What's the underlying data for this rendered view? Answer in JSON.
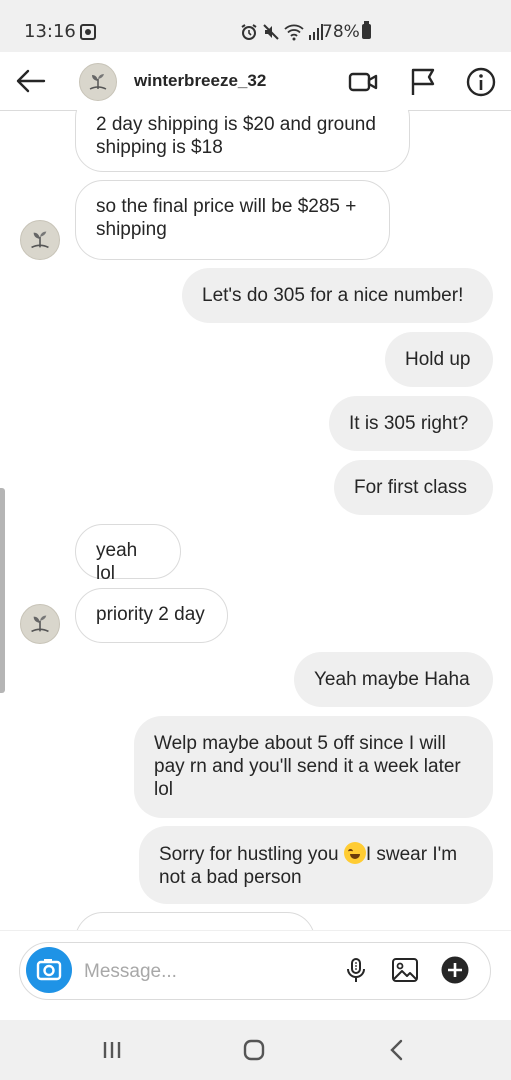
{
  "status_bar": {
    "time": "13:16",
    "battery": "78%",
    "icons": [
      "photo-notification-icon",
      "alarm-icon",
      "mute-icon",
      "wifi-icon",
      "signal-icon",
      "battery-icon"
    ]
  },
  "header": {
    "username": "winterbreeze_32",
    "icons": [
      "back-arrow-icon",
      "video-call-icon",
      "flag-icon",
      "info-icon"
    ]
  },
  "messages": [
    {
      "side": "in",
      "text": "2 day shipping is $20 and ground shipping is $18"
    },
    {
      "side": "in",
      "text": "so the final price will be $285 + shipping"
    },
    {
      "side": "out",
      "text": "Let's do 305 for a nice number!"
    },
    {
      "side": "out",
      "text": "Hold up"
    },
    {
      "side": "out",
      "text": "It is 305 right?"
    },
    {
      "side": "out",
      "text": "For first class"
    },
    {
      "side": "in",
      "text": "yeah lol"
    },
    {
      "side": "in",
      "text": "priority 2 day"
    },
    {
      "side": "out",
      "text": "Yeah maybe Haha"
    },
    {
      "side": "out",
      "text": "Welp maybe about 5 off since I will pay rn and you'll send it a week later lol"
    },
    {
      "side": "out",
      "text_before": "Sorry for hustling you ",
      "emoji": "grinning-squinting-face",
      "text_after": "I swear I'm not a bad person"
    }
  ],
  "composer": {
    "placeholder": "Message...",
    "icons": [
      "camera-icon",
      "microphone-icon",
      "gallery-icon",
      "add-icon"
    ]
  },
  "nav_bar": {
    "icons": [
      "recent-apps-icon",
      "home-icon",
      "back-icon"
    ]
  },
  "colors": {
    "camera_button": "#1f93e6",
    "outgoing_bubble": "#efefef",
    "incoming_border": "#dbdbdb",
    "text": "#262626",
    "placeholder": "#a8a8a8"
  }
}
